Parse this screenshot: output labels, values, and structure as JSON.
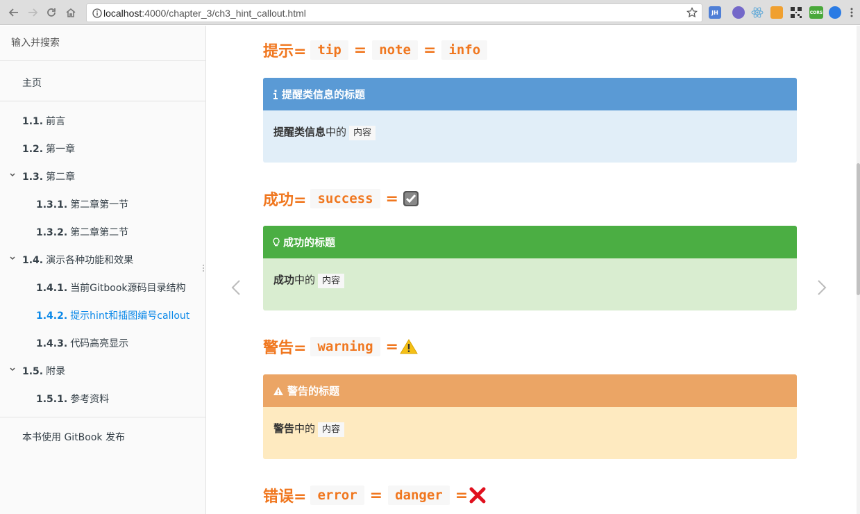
{
  "browser": {
    "url_host": "localhost",
    "url_path": ":4000/chapter_3/ch3_hint_callout.html",
    "extensions": [
      {
        "name": "jh-extension-icon",
        "label": "JH",
        "color": "#4f7fd6"
      },
      {
        "name": "extension-icon-2",
        "label": "",
        "color": "#7468c9"
      },
      {
        "name": "react-devtools-icon",
        "label": "",
        "color": "#61dafb"
      },
      {
        "name": "extension-icon-4",
        "label": "",
        "color": "#f0a030"
      },
      {
        "name": "qr-code-icon",
        "label": "",
        "color": "#333333"
      },
      {
        "name": "cors-icon",
        "label": "CORS",
        "color": "#49a83a"
      },
      {
        "name": "extension-icon-7",
        "label": "",
        "color": "#2a7be4"
      }
    ]
  },
  "sidebar": {
    "search_placeholder": "输入并搜索",
    "items": [
      {
        "num": "",
        "label": "主页"
      },
      {
        "num": "1.1.",
        "label": "前言"
      },
      {
        "num": "1.2.",
        "label": "第一章"
      },
      {
        "num": "1.3.",
        "label": "第二章"
      },
      {
        "num": "1.3.1.",
        "label": "第二章第一节"
      },
      {
        "num": "1.3.2.",
        "label": "第二章第二节"
      },
      {
        "num": "1.4.",
        "label": "演示各种功能和效果"
      },
      {
        "num": "1.4.1.",
        "label": "当前Gitbook源码目录结构"
      },
      {
        "num": "1.4.2.",
        "label": "提示hint和插图编号callout"
      },
      {
        "num": "1.4.3.",
        "label": "代码高亮显示"
      },
      {
        "num": "1.5.",
        "label": "附录"
      },
      {
        "num": "1.5.1.",
        "label": "参考资料"
      }
    ],
    "footer": "本书使用 GitBook 发布"
  },
  "content": {
    "sections": [
      {
        "heading_text": "提示=",
        "codes": [
          "tip",
          "note",
          "info"
        ],
        "title": "提醒类信息的标题",
        "body_bold": "提醒类信息",
        "body_rest": "中的",
        "body_code": "内容",
        "head_color": "#5a9ad5",
        "body_color": "#e1eef8"
      },
      {
        "heading_text": "成功=",
        "codes": [
          "success"
        ],
        "title": "成功的标题",
        "body_bold": "成功",
        "body_rest": "中的",
        "body_code": "内容",
        "head_color": "#4bae43",
        "body_color": "#d9edd0"
      },
      {
        "heading_text": "警告=",
        "codes": [
          "warning"
        ],
        "title": "警告的标题",
        "body_bold": "警告",
        "body_rest": "中的",
        "body_code": "内容",
        "head_color": "#eba565",
        "body_color": "#feeac0"
      },
      {
        "heading_text": "错误=",
        "codes": [
          "error",
          "danger"
        ]
      }
    ],
    "equals": "="
  }
}
